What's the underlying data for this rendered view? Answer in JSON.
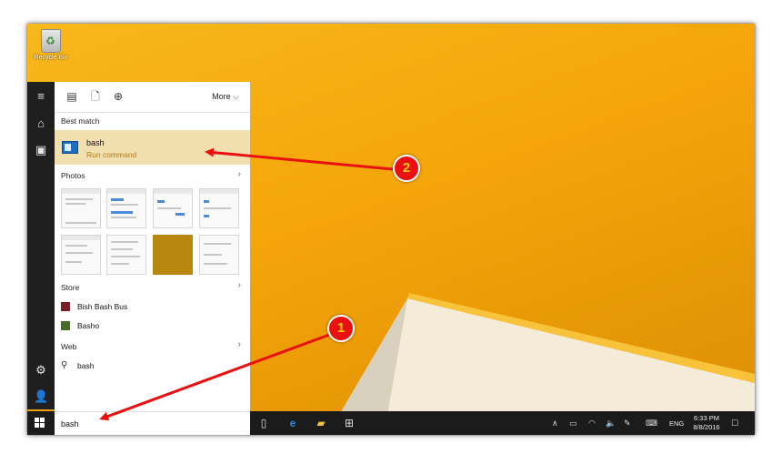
{
  "desktop": {
    "recycle_bin_label": "Recycle Bin"
  },
  "start_menu": {
    "rail_icons": [
      "hamburger-icon",
      "home-icon",
      "documents-icon",
      "settings-icon",
      "user-icon"
    ],
    "filter_icons": [
      "apps-icon",
      "documents-icon",
      "web-icon"
    ],
    "more_label": "More",
    "best_match": {
      "section": "Best match",
      "title": "bash",
      "subtitle": "Run command"
    },
    "photos_section": "Photos",
    "store_section": "Store",
    "store_items": [
      {
        "label": "Bish Bash Bus"
      },
      {
        "label": "Basho"
      }
    ],
    "web_section": "Web",
    "web_item": "bash"
  },
  "search": {
    "value": "bash"
  },
  "taskbar": {
    "lang": "ENG",
    "time": "6:33 PM",
    "date": "8/8/2016",
    "icons": [
      "task-view-icon",
      "edge-icon",
      "file-explorer-icon",
      "store-icon"
    ]
  },
  "annotations": [
    {
      "number": "1"
    },
    {
      "number": "2"
    }
  ],
  "colors": {
    "wallpaper": "#f5a50a",
    "best_match_highlight": "#f2dfb0",
    "arrow": "#ea1010",
    "taskbar": "#1b1b1b"
  }
}
